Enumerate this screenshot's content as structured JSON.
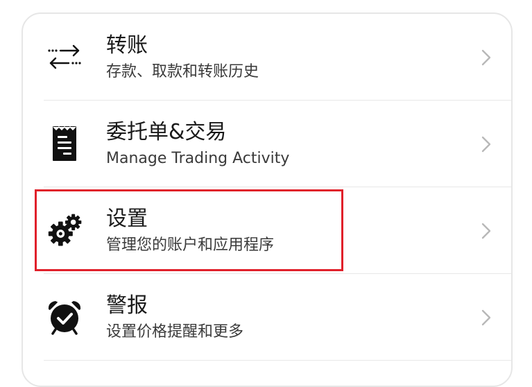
{
  "menu": {
    "items": [
      {
        "title": "转账",
        "subtitle": "存款、取款和转账历史",
        "icon": "transfer-arrows-icon"
      },
      {
        "title": "委托单&交易",
        "subtitle": "Manage Trading Activity",
        "icon": "receipt-icon"
      },
      {
        "title": "设置",
        "subtitle": "管理您的账户和应用程序",
        "icon": "gears-icon"
      },
      {
        "title": "警报",
        "subtitle": "设置价格提醒和更多",
        "icon": "alarm-clock-icon"
      }
    ]
  },
  "colors": {
    "highlight": "#e0202a",
    "chevron": "#b8b8b8",
    "text": "#1a1a1a"
  }
}
